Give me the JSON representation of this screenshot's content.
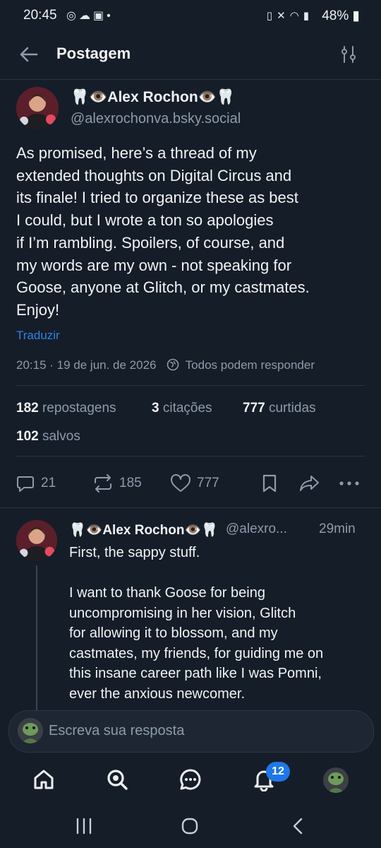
{
  "status_bar": {
    "time": "20:45",
    "battery": "48%",
    "left_icons": [
      "whatsapp-icon",
      "cloud-icon",
      "image-icon",
      "dot-icon"
    ],
    "right_icons": [
      "battery-saver-icon",
      "mute-icon",
      "wifi-icon",
      "signal-icon",
      "battery-icon"
    ]
  },
  "header": {
    "title": "Postagem"
  },
  "post": {
    "author_name": "🦷👁️Alex Rochon👁️🦷",
    "handle": "@alexrochonva.bsky.social",
    "text": "As promised, here’s a thread of my\nextended thoughts on Digital Circus and\nits finale! I tried to organize these as best\nI could, but I wrote a ton so apologies\nif I’m rambling. Spoilers, of course, and\nmy words are my own - not speaking for\nGoose, anyone at Glitch, or my castmates.\nEnjoy!",
    "translate_label": "Traduzir",
    "timestamp": "20:15 · 19 de jun. de 2026",
    "reply_setting": "Todos podem responder",
    "stats": {
      "reposts_count": "182",
      "reposts_label": "repostagens",
      "quotes_count": "3",
      "quotes_label": "citações",
      "likes_count": "777",
      "likes_label": "curtidas",
      "saves_count": "102",
      "saves_label": "salvos"
    },
    "actions": {
      "replies": "21",
      "reposts": "185",
      "likes": "777"
    }
  },
  "reply": {
    "author_name": "🦷👁️Alex Rochon👁️🦷",
    "handle": "@alexro...",
    "time": "29min",
    "text": "First, the sappy stuff.\n\nI want to thank Goose for being\nuncompromising in her vision, Glitch\nfor allowing it to blossom, and my\ncastmates, my friends, for guiding me on\nthis insane career path like I was Pomni,\never the anxious newcomer."
  },
  "composer": {
    "placeholder": "Escreva sua resposta"
  },
  "bottom_nav": {
    "notifications_badge": "12"
  },
  "colors": {
    "background": "#151d28",
    "accent": "#1d77e8",
    "muted": "#8e9bab"
  }
}
